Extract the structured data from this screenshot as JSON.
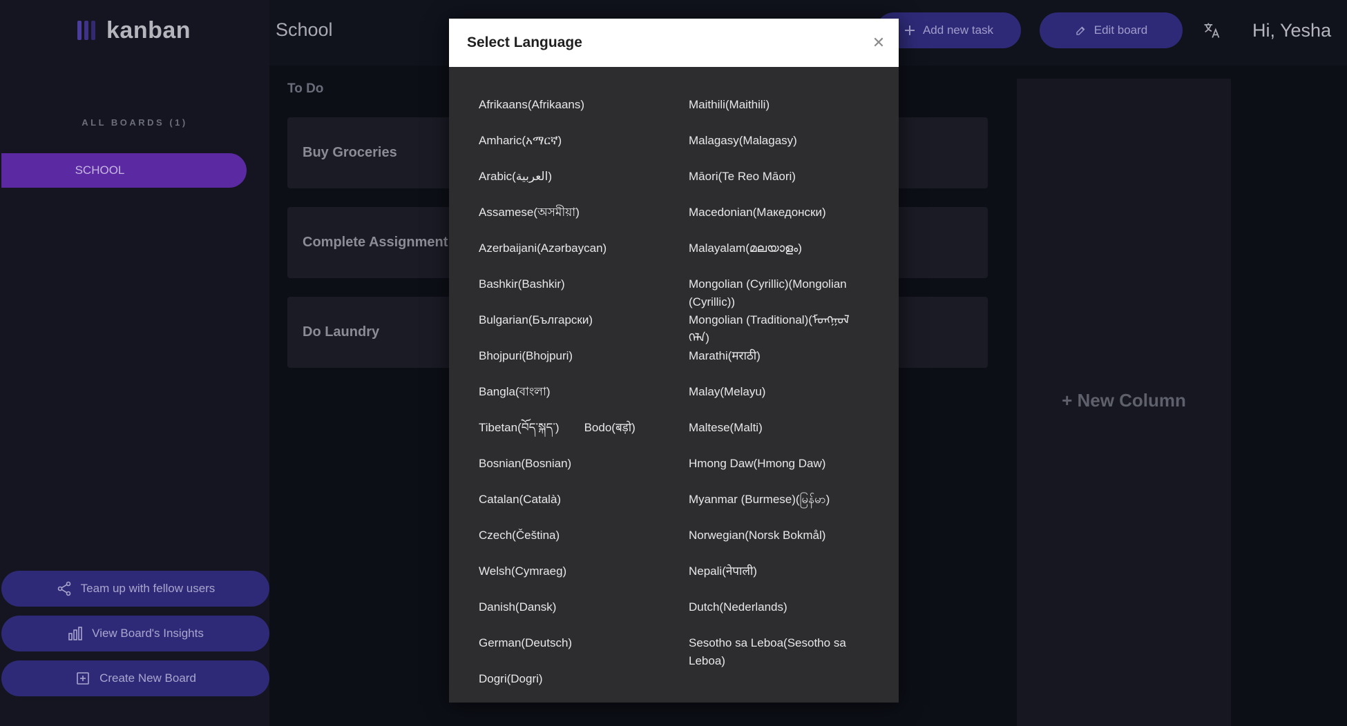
{
  "app": {
    "logo_text": "kanban",
    "board_title": "School",
    "greeting": "Hi, Yesha"
  },
  "sidebar": {
    "all_boards_label": "ALL BOARDS (1)",
    "boards": [
      "SCHOOL"
    ],
    "team_up_label": "Team up with fellow users",
    "insights_label": "View Board's Insights",
    "create_board_label": "Create New Board"
  },
  "header": {
    "add_task_label": "Add new task",
    "edit_board_label": "Edit board"
  },
  "board": {
    "column_title": "To Do",
    "tasks": [
      "Buy Groceries",
      "Complete Assignment",
      "Do Laundry"
    ],
    "new_column_label": "+ New Column"
  },
  "colors": {
    "accent": "#5b2aa3",
    "button_bg": "#2e2a77",
    "modal_bg": "#2d2d2f"
  },
  "modal": {
    "title": "Select Language",
    "close_icon": "close-icon",
    "left_column": [
      "Afrikaans(Afrikaans)",
      "Amharic(አማርኛ)",
      "Arabic(العربية)",
      "Assamese(অসমীয়া)",
      "Azerbaijani(Azərbaycan)",
      "Bashkir(Bashkir)",
      "Bulgarian(Български)",
      "Bhojpuri(Bhojpuri)",
      "Bangla(বাংলা)",
      "Tibetan(བོད་སྐད་)",
      "Bodo(बड़ो)",
      "Bosnian(Bosnian)",
      "Catalan(Català)",
      "Czech(Čeština)",
      "Welsh(Cymraeg)",
      "Danish(Dansk)",
      "German(Deutsch)",
      "Dogri(Dogri)"
    ],
    "right_column": [
      "Maithili(Maithili)",
      "Malagasy(Malagasy)",
      "Māori(Te Reo Māori)",
      "Macedonian(Македонски)",
      "Malayalam(മലയാളം)",
      "Mongolian (Cyrillic)(Mongolian (Cyrillic))",
      "Mongolian (Traditional)(ᠮᠣᠩᠭᠣᠯ ᠬᠡᠯᠡ)",
      "Marathi(मराठी)",
      "Malay(Melayu)",
      "Maltese(Malti)",
      "Hmong Daw(Hmong Daw)",
      "Myanmar (Burmese)(မြန်မာ)",
      "Norwegian(Norsk Bokmål)",
      "Nepali(नेपाली)",
      "Dutch(Nederlands)",
      "Sesotho sa Leboa(Sesotho sa Leboa)"
    ]
  }
}
